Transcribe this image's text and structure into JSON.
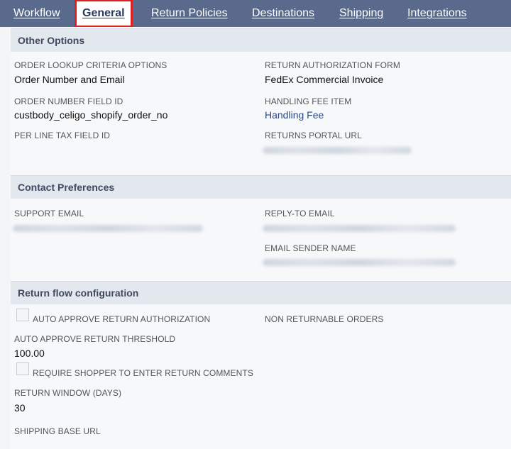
{
  "tabs": [
    {
      "label": "Workflow",
      "active": false
    },
    {
      "label": "General",
      "active": true
    },
    {
      "label": "Return Policies",
      "active": false
    },
    {
      "label": "Destinations",
      "active": false
    },
    {
      "label": "Shipping",
      "active": false
    },
    {
      "label": "Integrations",
      "active": false
    }
  ],
  "other_options": {
    "title": "Other Options",
    "order_lookup_label": "ORDER LOOKUP CRITERIA OPTIONS",
    "order_lookup_value": "Order Number and Email",
    "return_auth_form_label": "RETURN AUTHORIZATION FORM",
    "return_auth_form_value": "FedEx Commercial Invoice",
    "order_number_field_label": "ORDER NUMBER FIELD ID",
    "order_number_field_value": "custbody_celigo_shopify_order_no",
    "handling_fee_label": "HANDLING FEE ITEM",
    "handling_fee_value": "Handling Fee",
    "per_line_tax_label": "PER LINE TAX FIELD ID",
    "returns_portal_label": "RETURNS PORTAL URL"
  },
  "contact_preferences": {
    "title": "Contact Preferences",
    "support_email_label": "SUPPORT EMAIL",
    "reply_to_label": "REPLY-TO EMAIL",
    "sender_name_label": "EMAIL SENDER NAME"
  },
  "return_flow": {
    "title": "Return flow configuration",
    "auto_approve_label": "AUTO APPROVE RETURN AUTHORIZATION",
    "auto_approve_checked": false,
    "non_returnable_label": "NON RETURNABLE ORDERS",
    "threshold_label": "AUTO APPROVE RETURN THRESHOLD",
    "threshold_value": "100.00",
    "require_comments_label": "REQUIRE SHOPPER TO ENTER RETURN COMMENTS",
    "require_comments_checked": false,
    "window_label": "RETURN WINDOW (DAYS)",
    "window_value": "30",
    "shipping_base_url_label": "SHIPPING BASE URL"
  },
  "colors": {
    "tab_bar": "#5a6a8c",
    "active_tab_outline": "#e02020",
    "section_header_bg": "#e3e7ee",
    "link": "#2d4a80"
  }
}
